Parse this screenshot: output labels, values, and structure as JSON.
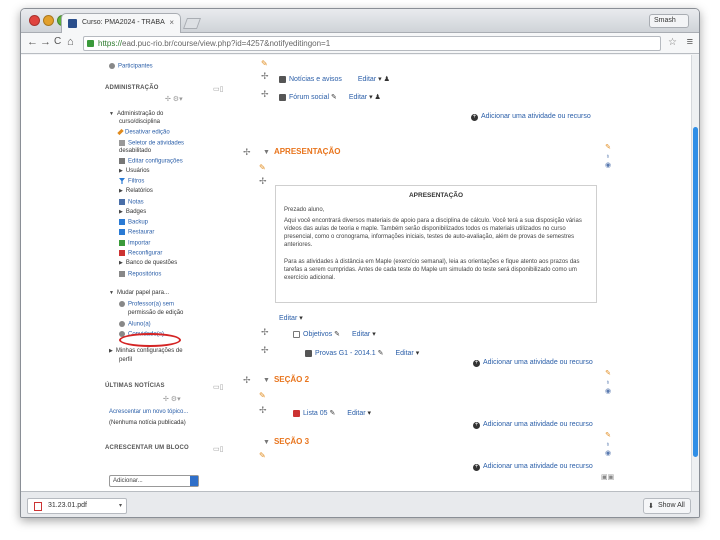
{
  "browser": {
    "tab_title": "Curso: PMA2024 - TRABA",
    "tab_close": "×",
    "profile_label": "Smash",
    "url_scheme": "https://",
    "url_host": "ead.puc-rio.br",
    "url_path": "/course/view.php?id=4257&notifyeditingon=1",
    "nav": {
      "back": "←",
      "forward": "→",
      "reload": "C",
      "home": "⌂"
    },
    "star": "☆",
    "menu": "≡"
  },
  "sidebar": {
    "participants": "Participantes",
    "admin_heading": "ADMINISTRAÇÃO",
    "admin_items": [
      "Administração do",
      "curso/disciplina",
      "Desativar edição",
      "Seletor de atividades",
      "desabilitado",
      "Editar configurações",
      "Usuários",
      "Filtros",
      "Relatórios",
      "Notas",
      "Badges",
      "Backup",
      "Restaurar",
      "Importar",
      "Reconfigurar",
      "Banco de questões",
      "Repositórios"
    ],
    "role_items": [
      "Mudar papel para...",
      "Professor(a) sem",
      "permissão de edição",
      "Aluno(a)",
      "Convidado(a)"
    ],
    "profile_settings": [
      "Minhas configurações de",
      "perfil"
    ],
    "news_heading": "ÚLTIMAS NOTÍCIAS",
    "news_add": "Acrescentar um novo tópico...",
    "news_none": "(Nenhuma notícia publicada)",
    "block_heading": "ACRESCENTAR UM BLOCO",
    "block_select": "Adicionar..."
  },
  "main": {
    "top_items": [
      {
        "label": "Notícias e avisos",
        "edit": "Editar"
      },
      {
        "label": "Fórum social",
        "edit": "Editar"
      }
    ],
    "add_activity": "Adicionar uma atividade ou recurso",
    "section_apresentacao": {
      "title": "APRESENTAÇÃO",
      "box_title": "APRESENTAÇÃO",
      "greeting": "Prezado aluno,",
      "para1": "Aqui você encontrará diversos materiais de apoio para a disciplina de cálculo. Você terá a sua disposição várias vídeos das aulas de teoria e maple. Também serão disponibilizados todos os materiais utilizados no curso presencial, como o cronograma, informações iniciais, testes de auto-avaliação, além de provas de semestres anteriores.",
      "para2": "Para as atividades à distância em Maple (exercício semanal), leia as orientações e fique atento aos prazos das tarefas a serem cumpridas. Antes de cada teste do Maple  um simulado do teste será disponibilizado como um exercício adicional.",
      "edit": "Editar",
      "items": [
        {
          "label": "Objetivos",
          "edit": "Editar"
        },
        {
          "label": "Provas G1 - 2014.1",
          "edit": "Editar"
        }
      ]
    },
    "section2": {
      "title": "SEÇÃO 2",
      "items": [
        {
          "label": "Lista 05",
          "edit": "Editar"
        }
      ]
    },
    "section3": {
      "title": "SEÇÃO 3"
    }
  },
  "status": {
    "download_file": "31.23.01.pdf",
    "show_all": "Show All"
  },
  "colors": {
    "section_orange": "#e8741c",
    "link_blue": "#2a5ea8",
    "annotation_red": "#d42424",
    "scroll_blue": "#2f8ee6"
  }
}
